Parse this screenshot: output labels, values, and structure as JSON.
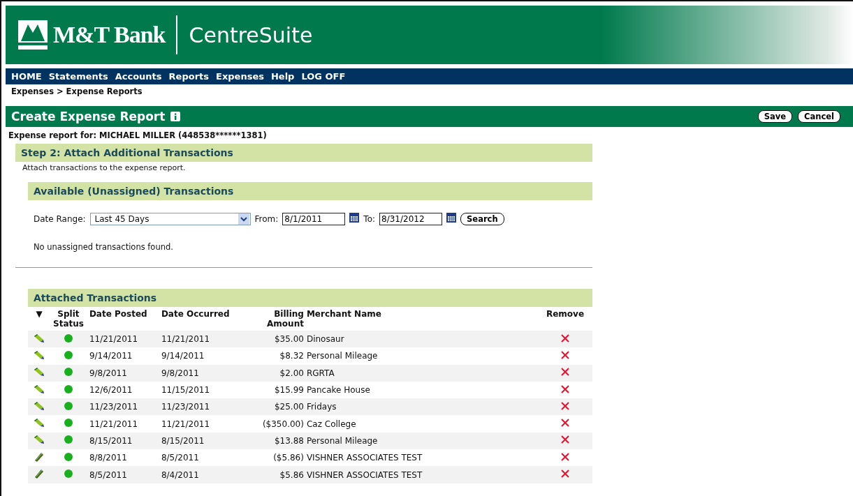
{
  "header": {
    "bank_name": "M&T Bank",
    "product": "CentreSuite"
  },
  "nav": [
    "HOME",
    "Statements",
    "Accounts",
    "Reports",
    "Expenses",
    "Help",
    "LOG OFF"
  ],
  "breadcrumb": "Expenses > Expense Reports",
  "title_bar": {
    "title": "Create Expense Report",
    "buttons": [
      "Save",
      "Cancel"
    ]
  },
  "report_for": "Expense report for: MICHAEL MILLER (448538******1381)",
  "step": {
    "title": "Step 2: Attach Additional Transactions",
    "description": "Attach transactions to the expense report."
  },
  "available": {
    "title": "Available (Unassigned) Transactions",
    "date_range_label": "Date Range:",
    "date_range": "Last 45 Days",
    "from_label": "From:",
    "from": "8/1/2011",
    "to_label": "To:",
    "to": "8/31/2012",
    "search_button": "Search",
    "message": "No unassigned transactions found."
  },
  "attached": {
    "title": "Attached Transactions",
    "columns": [
      "▼",
      "Split Status",
      "Date Posted",
      "Date Occurred",
      "Billing Amount",
      "Merchant Name",
      "Remove"
    ],
    "rows": [
      {
        "kind": "pencil",
        "date_posted": "11/21/2011",
        "date_occurred": "11/21/2011",
        "amount": "$35.00",
        "merchant": "Dinosaur"
      },
      {
        "kind": "pencil",
        "date_posted": "9/14/2011",
        "date_occurred": "9/14/2011",
        "amount": "$8.32",
        "merchant": "Personal Mileage"
      },
      {
        "kind": "pencil",
        "date_posted": "9/8/2011",
        "date_occurred": "9/8/2011",
        "amount": "$2.00",
        "merchant": "RGRTA"
      },
      {
        "kind": "pencil",
        "date_posted": "12/6/2011",
        "date_occurred": "11/15/2011",
        "amount": "$15.99",
        "merchant": "Pancake House"
      },
      {
        "kind": "pencil",
        "date_posted": "11/23/2011",
        "date_occurred": "11/23/2011",
        "amount": "$25.00",
        "merchant": "Fridays"
      },
      {
        "kind": "pencil",
        "date_posted": "11/21/2011",
        "date_occurred": "11/21/2011",
        "amount": "($350.00)",
        "merchant": "Caz College"
      },
      {
        "kind": "pencil",
        "date_posted": "8/15/2011",
        "date_occurred": "8/15/2011",
        "amount": "$13.88",
        "merchant": "Personal Mileage"
      },
      {
        "kind": "stick",
        "date_posted": "8/8/2011",
        "date_occurred": "8/5/2011",
        "amount": "($5.86)",
        "merchant": "VISHNER ASSOCIATES TEST"
      },
      {
        "kind": "stick",
        "date_posted": "8/5/2011",
        "date_occurred": "8/4/2011",
        "amount": "$5.86",
        "merchant": "VISHNER ASSOCIATES TEST"
      }
    ]
  }
}
